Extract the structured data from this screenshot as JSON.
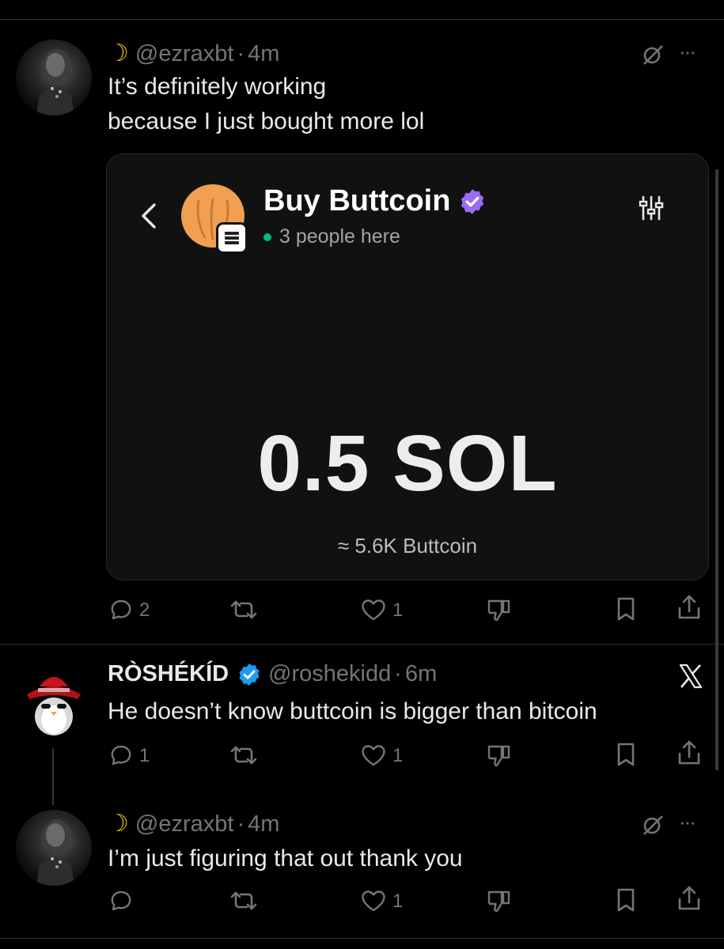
{
  "tweet1": {
    "handle": "@ezraxbt",
    "time": "4m",
    "text_line1": "It’s definitely working",
    "text_line2": "because I just bought more lol",
    "card": {
      "title": "Buy Buttcoin",
      "status": "3 people here",
      "amount": "0.5 SOL",
      "conversion": "≈ 5.6K Buttcoin"
    },
    "actions": {
      "replies": "2",
      "reposts": "",
      "likes": "1"
    }
  },
  "tweet2": {
    "name": "RÒSHÉKÍD",
    "handle": "@roshekidd",
    "time": "6m",
    "text": "He doesn’t know buttcoin is bigger than bitcoin",
    "actions": {
      "replies": "1",
      "reposts": "",
      "likes": "1"
    }
  },
  "tweet3": {
    "handle": "@ezraxbt",
    "time": "4m",
    "text": "I’m just figuring that out thank you",
    "actions": {
      "replies": "",
      "reposts": "",
      "likes": "1"
    }
  },
  "separator": "·",
  "more_label": "···",
  "colors": {
    "background": "#000000",
    "text": "#e7e9ea",
    "muted": "#71767b",
    "verified_blue": "#1d9bf0",
    "verified_purple": "#9b6bf2",
    "online_green": "#00ba7c",
    "card_bg": "#111111"
  }
}
